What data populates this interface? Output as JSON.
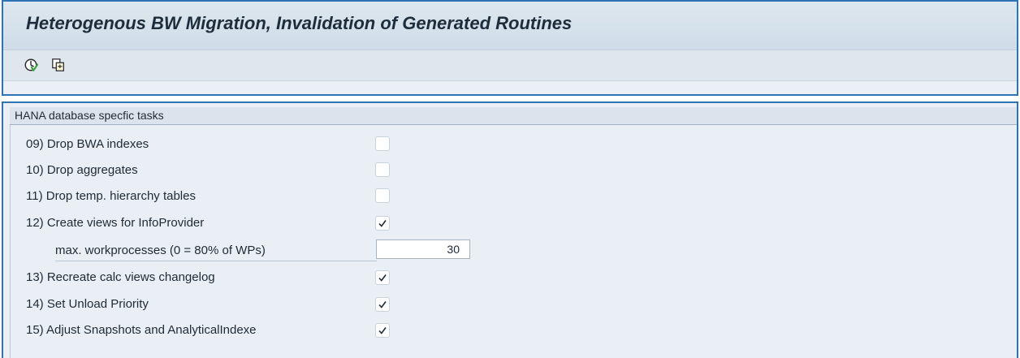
{
  "header": {
    "title": "Heterogenous BW Migration, Invalidation of Generated Routines",
    "toolbar": [
      {
        "name": "execute-icon"
      },
      {
        "name": "get-variant-icon"
      }
    ]
  },
  "group": {
    "title": "HANA database specfic tasks",
    "rows": [
      {
        "label": "09) Drop BWA indexes",
        "checked": false
      },
      {
        "label": "10) Drop aggregates",
        "checked": false
      },
      {
        "label": "11) Drop temp. hierarchy tables",
        "checked": false
      },
      {
        "label": "12) Create views for InfoProvider",
        "checked": true
      },
      {
        "label": "13) Recreate calc views changelog",
        "checked": true
      },
      {
        "label": "14) Set Unload Priority",
        "checked": true
      },
      {
        "label": "15) Adjust Snapshots and AnalyticalIndexe",
        "checked": true
      }
    ],
    "workprocesses": {
      "label": "max. workprocesses (0 = 80% of WPs)",
      "value": "30"
    }
  },
  "colors": {
    "frame_border": "#2e74b5",
    "panel_bg": "#e9eff5",
    "checkmark": "#1f2a35"
  }
}
